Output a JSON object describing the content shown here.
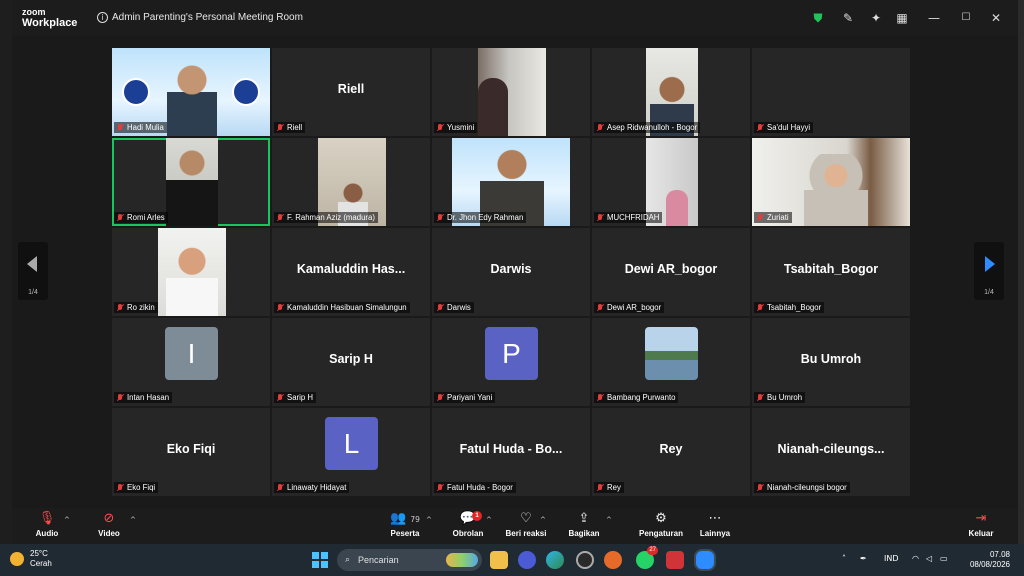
{
  "window": {
    "brand_top": "zoom",
    "brand_bottom": "Workplace",
    "meeting_title": "Admin Parenting's Personal Meeting Room"
  },
  "tiles": [
    {
      "label": "Hadi Mulia",
      "kind": "video",
      "scene": "banner"
    },
    {
      "label": "Riell",
      "kind": "name",
      "big": "Riell"
    },
    {
      "label": "Yusmini",
      "kind": "video",
      "scene": "room"
    },
    {
      "label": "Asep Ridwanulloh - Bogor",
      "kind": "video",
      "scene": "man"
    },
    {
      "label": "Sa'dul Hayyi",
      "kind": "blank"
    },
    {
      "label": "Romi Arles",
      "kind": "video",
      "scene": "man-dark",
      "active": true
    },
    {
      "label": "F. Rahman Aziz (madura)",
      "kind": "video",
      "scene": "wall"
    },
    {
      "label": "Dr. Jhon Edy Rahman",
      "kind": "video",
      "scene": "banner2"
    },
    {
      "label": "MUCHFRIDAH",
      "kind": "video",
      "scene": "door"
    },
    {
      "label": "Zuriati",
      "kind": "video",
      "scene": "hijab"
    },
    {
      "label": "Ro zikin",
      "kind": "video",
      "scene": "cap"
    },
    {
      "label": "Kamaluddin Hasibuan Simalungun",
      "kind": "name",
      "big": "Kamaluddin  Has..."
    },
    {
      "label": "Darwis",
      "kind": "name",
      "big": "Darwis"
    },
    {
      "label": "Dewi AR_bogor",
      "kind": "name",
      "big": "Dewi AR_bogor"
    },
    {
      "label": "Tsabitah_Bogor",
      "kind": "name",
      "big": "Tsabitah_Bogor"
    },
    {
      "label": "Intan Hasan",
      "kind": "avatar",
      "letter": "I",
      "color": "#7d8c96"
    },
    {
      "label": "Sarip H",
      "kind": "name",
      "big": "Sarip H"
    },
    {
      "label": "Pariyani Yani",
      "kind": "avatar",
      "letter": "P",
      "color": "#5a62c4"
    },
    {
      "label": "Bambang Purwanto",
      "kind": "photo"
    },
    {
      "label": "Bu Umroh",
      "kind": "name",
      "big": "Bu Umroh"
    },
    {
      "label": "Eko Fiqi",
      "kind": "name",
      "big": "Eko Fiqi"
    },
    {
      "label": "Linawaty Hidayat",
      "kind": "avatar",
      "letter": "L",
      "color": "#5a62c4"
    },
    {
      "label": "Fatul Huda - Bogor",
      "kind": "name",
      "big": "Fatul Huda - Bo..."
    },
    {
      "label": "Rey",
      "kind": "name",
      "big": "Rey"
    },
    {
      "label": "Nianah-cileungsi bogor",
      "kind": "name",
      "big": "Nianah-cileungs..."
    }
  ],
  "nav": {
    "left_page": "1/4",
    "right_page": "1/4"
  },
  "toolbar": {
    "audio": "Audio",
    "video": "Video",
    "participants": "Peserta",
    "participants_count": "79",
    "chat": "Obrolan",
    "chat_badge": "1",
    "reactions": "Beri reaksi",
    "share": "Bagikan",
    "settings": "Pengaturan",
    "more": "Lainnya",
    "leave": "Keluar"
  },
  "taskbar": {
    "temp": "25°C",
    "weather": "Cerah",
    "search_placeholder": "Pencarian",
    "lang": "IND",
    "time": "07.08",
    "date": "08/08/2026",
    "whatsapp_badge": "27"
  },
  "icons": {
    "security": "shield-icon",
    "colors": {
      "accent_green": "#19c55e",
      "leave_red": "#ff4d4d",
      "nav_blue": "#2d8cff"
    }
  }
}
